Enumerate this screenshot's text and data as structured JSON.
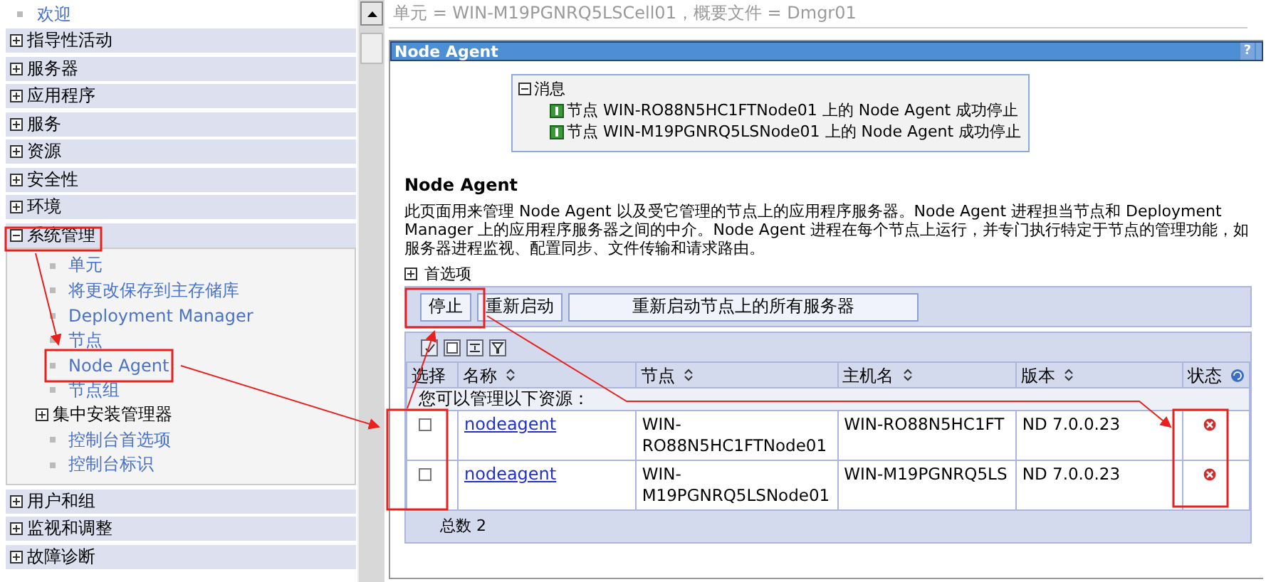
{
  "nav": {
    "welcome": "欢迎",
    "items": [
      {
        "label": "指导性活动",
        "expanded": false
      },
      {
        "label": "服务器",
        "expanded": false
      },
      {
        "label": "应用程序",
        "expanded": false
      },
      {
        "label": "服务",
        "expanded": false
      },
      {
        "label": "资源",
        "expanded": false
      },
      {
        "label": "安全性",
        "expanded": false
      },
      {
        "label": "环境",
        "expanded": false
      },
      {
        "label": "系统管理",
        "expanded": true,
        "children": [
          {
            "kind": "link",
            "label": "单元"
          },
          {
            "kind": "link",
            "label": "将更改保存到主存储库"
          },
          {
            "kind": "link",
            "label": "Deployment Manager"
          },
          {
            "kind": "link",
            "label": "节点"
          },
          {
            "kind": "link",
            "label": "Node Agent"
          },
          {
            "kind": "link",
            "label": "节点组"
          },
          {
            "kind": "group",
            "label": "集中安装管理器",
            "expanded": false
          },
          {
            "kind": "link",
            "label": "控制台首选项"
          },
          {
            "kind": "link",
            "label": "控制台标识"
          }
        ]
      },
      {
        "label": "用户和组",
        "expanded": false
      },
      {
        "label": "监视和调整",
        "expanded": false
      },
      {
        "label": "故障诊断",
        "expanded": false
      }
    ]
  },
  "breadcrumb": "单元 = WIN-M19PGNRQ5LSCell01，概要文件 = Dmgr01",
  "panel": {
    "title": "Node Agent",
    "help": "?",
    "messages": {
      "title": "消息",
      "expanded": true,
      "items": [
        "节点 WIN-RO88N5HC1FTNode01 上的 Node Agent 成功停止",
        "节点 WIN-M19PGNRQ5LSNode01 上的 Node Agent 成功停止"
      ]
    },
    "heading": "Node Agent",
    "description": "此页面用来管理 Node Agent 以及受它管理的节点上的应用程序服务器。Node Agent 进程担当节点和 Deployment Manager 上的应用程序服务器之间的中介。Node Agent 进程在每个节点上运行，并专门执行特定于节点的管理功能，如服务器进程监视、配置同步、文件传输和请求路由。",
    "preferences": {
      "label": "首选项",
      "expanded": false
    },
    "buttons": [
      "停止",
      "重新启动",
      "重新启动节点上的所有服务器"
    ],
    "table": {
      "columns": [
        {
          "label": "选择",
          "kind": "plain"
        },
        {
          "label": "名称",
          "kind": "sortable"
        },
        {
          "label": "节点",
          "kind": "sortable"
        },
        {
          "label": "主机名",
          "kind": "sortable"
        },
        {
          "label": "版本",
          "kind": "sortable"
        },
        {
          "label": "状态",
          "kind": "refresh"
        }
      ],
      "note": "您可以管理以下资源：",
      "rows": [
        {
          "checked": false,
          "name": "nodeagent",
          "node": "WIN-RO88N5HC1FTNode01",
          "host": "WIN-RO88N5HC1FT",
          "version": "ND 7.0.0.23",
          "stopped": true
        },
        {
          "checked": false,
          "name": "nodeagent",
          "node": "WIN-M19PGNRQ5LSNode01",
          "host": "WIN-M19PGNRQ5LS",
          "version": "ND 7.0.0.23",
          "stopped": true
        }
      ],
      "total": "总数 2"
    }
  }
}
